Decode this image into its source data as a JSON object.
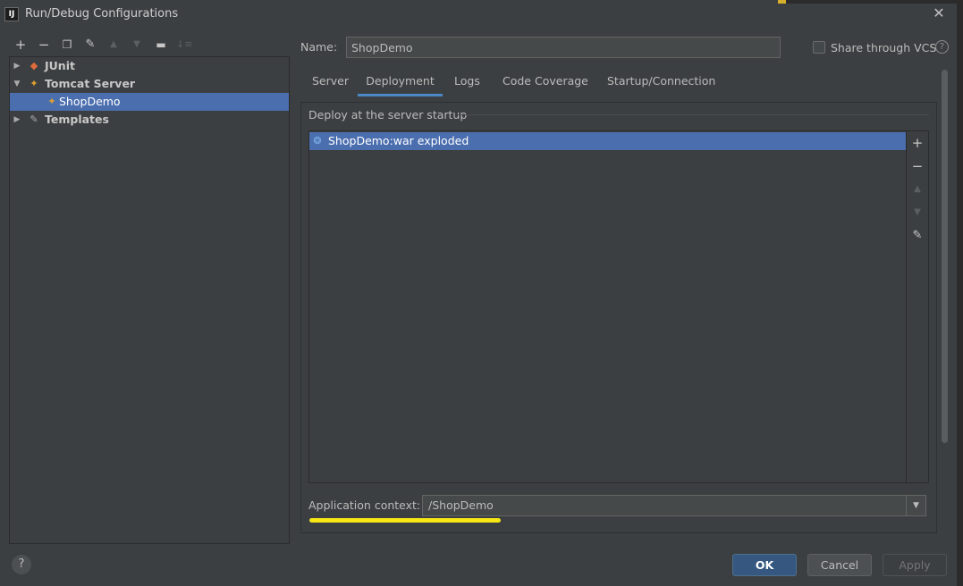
{
  "window": {
    "title": "Run/Debug Configurations",
    "app_icon": "IJ",
    "close_glyph": "✕"
  },
  "toolbar": {
    "icons": [
      "add-icon",
      "remove-icon",
      "copy-icon",
      "wrench-icon",
      "move-up-icon",
      "move-down-icon",
      "new-folder-icon",
      "sort-icon"
    ]
  },
  "tree": {
    "items": [
      {
        "label": "JUnit",
        "icon": "junit-icon",
        "expanded": false
      },
      {
        "label": "Tomcat Server",
        "icon": "tomcat-icon",
        "expanded": true
      },
      {
        "label": "ShopDemo",
        "icon": "tomcat-icon",
        "selected": true
      },
      {
        "label": "Templates",
        "icon": "wrench-icon",
        "expanded": false
      }
    ]
  },
  "config": {
    "name_label": "Name:",
    "name_value": "ShopDemo",
    "share_label": "Share through VCS",
    "share_checked": false,
    "help_glyph": "?"
  },
  "tabs": [
    {
      "label": "Server"
    },
    {
      "label": "Deployment",
      "active": true
    },
    {
      "label": "Logs"
    },
    {
      "label": "Code Coverage"
    },
    {
      "label": "Startup/Connection"
    }
  ],
  "deployment": {
    "section_title": "Deploy at the server startup",
    "artifacts": [
      {
        "label": "ShopDemo:war exploded",
        "selected": true
      }
    ],
    "app_context_label": "Application context:",
    "app_context_value": "/ShopDemo"
  },
  "buttons": {
    "help": "?",
    "ok": "OK",
    "cancel": "Cancel",
    "apply": "Apply"
  },
  "colors": {
    "selection": "#4b6eaf",
    "ok_button": "#365880",
    "tab_underline": "#4a88c7",
    "highlight_annotation": "#f5e614"
  }
}
